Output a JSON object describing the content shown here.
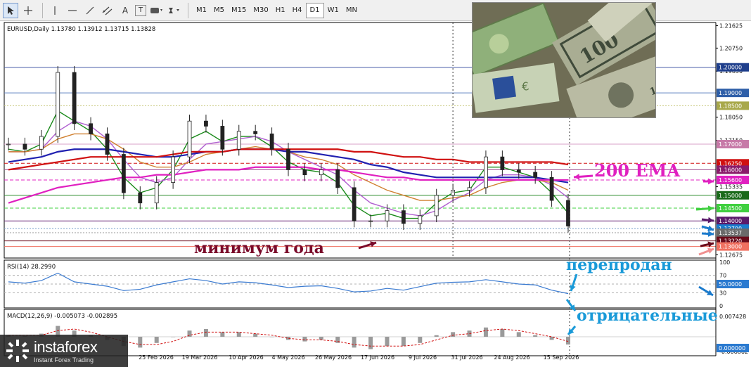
{
  "toolbar": {
    "tools": [
      "cursor-icon",
      "crosshair-icon",
      "vertical-line-icon",
      "horizontal-line-icon",
      "trendline-icon",
      "channel-icon",
      "text-tool-icon",
      "label-tool-icon",
      "shapes-icon",
      "arrows-icon"
    ],
    "text_tool": "A",
    "label_tool": "T",
    "timeframes": [
      "M1",
      "M5",
      "M15",
      "M30",
      "H1",
      "H4",
      "D1",
      "W1",
      "MN"
    ],
    "active_timeframe": "D1"
  },
  "header": {
    "symbol_info": "EURUSD,Daily  1.13780 1.13912 1.13715 1.13828"
  },
  "price_axis": {
    "ticks": [
      "1.21625",
      "1.20750",
      "1.19850",
      "1.18050",
      "1.17150",
      "1.15335",
      "1.12675"
    ],
    "levels": [
      {
        "label": "1.20000",
        "value": 1.2,
        "bg": "#1f3f8c",
        "fg": "#ffffff",
        "line": "#4a5fa8",
        "style": "solid"
      },
      {
        "label": "1.19000",
        "value": 1.19,
        "bg": "#2f5fa8",
        "fg": "#ffffff",
        "line": "#5b7fbf",
        "style": "solid"
      },
      {
        "label": "1.18500",
        "value": 1.185,
        "bg": "#a8a84a",
        "fg": "#ffffff",
        "line": "#c8c87a",
        "style": "dotted"
      },
      {
        "label": "1.17000",
        "value": 1.17,
        "bg": "#c77aa8",
        "fg": "#ffffff",
        "line": "#d8a0c8",
        "style": "solid"
      },
      {
        "label": "1.16250",
        "value": 1.1625,
        "bg": "#d01010",
        "fg": "#ffffff",
        "line": "#d01010",
        "style": "dashed"
      },
      {
        "label": "1.16000",
        "value": 1.16,
        "bg": "#8a1a6a",
        "fg": "#ffffff",
        "line": "#a05090",
        "style": "solid"
      },
      {
        "label": "1.15600",
        "value": 1.156,
        "bg": "#e020c0",
        "fg": "#ffffff",
        "line": "#e020c0",
        "style": "dashed"
      },
      {
        "label": "1.15000",
        "value": 1.15,
        "bg": "#1a6a1a",
        "fg": "#ffffff",
        "line": "#2a8a2a",
        "style": "solid"
      },
      {
        "label": "1.14500",
        "value": 1.145,
        "bg": "#40d040",
        "fg": "#ffffff",
        "line": "#40d040",
        "style": "dashed"
      },
      {
        "label": "1.14000",
        "value": 1.14,
        "bg": "#5a1a6a",
        "fg": "#ffffff",
        "line": "#6a2a7a",
        "style": "solid"
      },
      {
        "label": "1.13700",
        "value": 1.137,
        "bg": "#1a7acc",
        "fg": "#ffffff",
        "line": "#7aa0cc",
        "style": "dotted"
      },
      {
        "label": "1.13537",
        "value": 1.13537,
        "bg": "#6a6a6a",
        "fg": "#ffffff",
        "line": "#9a9a9a",
        "style": "dotted"
      },
      {
        "label": "1.13220",
        "value": 1.1322,
        "bg": "#6a0a1a",
        "fg": "#ffffff",
        "line": "#6a0a1a",
        "style": "solid"
      },
      {
        "label": "1.13000",
        "value": 1.13,
        "bg": "#f07060",
        "fg": "#ffffff",
        "line": "#f07060",
        "style": "solid"
      }
    ]
  },
  "date_axis": [
    "25 Feb 2026",
    "19 Mar 2026",
    "10 Apr 2026",
    "4 May 2026",
    "26 May 2026",
    "17 Jun 2026",
    "9 Jul 2026",
    "31 Jul 2026",
    "24 Aug 2026",
    "15 Sep 2026"
  ],
  "rsi": {
    "label": "RSI(14) 28.2990",
    "ticks": [
      "100",
      "70",
      "30",
      "0"
    ],
    "badge": "50.0000",
    "badge_bg": "#2a7ad0"
  },
  "macd": {
    "label": "MACD(12,26,9) -0.005073 -0.002895",
    "ticks": [
      "0.007428",
      "-0.008862"
    ],
    "badge": "0.000000",
    "badge_bg": "#2a7ad0"
  },
  "annotations": {
    "ema": {
      "text": "200 EMA",
      "color": "#e020c0"
    },
    "year_low": {
      "text": "минимум года",
      "color": "#7a0a2a"
    },
    "oversold": {
      "text": "перепродан",
      "color": "#1a9ad8"
    },
    "negative": {
      "text": "отрицательные",
      "color": "#1a9ad8"
    }
  },
  "logo": {
    "name": "instaforex",
    "tagline": "Instant Forex Trading"
  },
  "chart_data": {
    "type": "candlestick",
    "symbol": "EURUSD",
    "timeframe": "Daily",
    "last_ohlc": {
      "open": 1.1378,
      "high": 1.13912,
      "low": 1.13715,
      "close": 1.13828
    },
    "ylim": [
      1.1255,
      1.2175
    ],
    "x": [
      "2026-01-26",
      "2026-02-02",
      "2026-02-09",
      "2026-02-16",
      "2026-02-23",
      "2026-03-02",
      "2026-03-09",
      "2026-03-16",
      "2026-03-23",
      "2026-03-30",
      "2026-04-06",
      "2026-04-13",
      "2026-04-20",
      "2026-04-27",
      "2026-05-04",
      "2026-05-11",
      "2026-05-18",
      "2026-05-25",
      "2026-06-01",
      "2026-06-08",
      "2026-06-15",
      "2026-06-22",
      "2026-06-29",
      "2026-07-06",
      "2026-07-13",
      "2026-07-20",
      "2026-07-27",
      "2026-08-03",
      "2026-08-10",
      "2026-08-17",
      "2026-08-24",
      "2026-08-31",
      "2026-09-07",
      "2026-09-14",
      "2026-09-21"
    ],
    "series": [
      {
        "name": "",
        "role": "price",
        "color": "#222222",
        "values": [
          1.17,
          1.168,
          1.173,
          1.198,
          1.178,
          1.174,
          1.166,
          1.151,
          1.147,
          1.155,
          1.165,
          1.179,
          1.177,
          1.168,
          1.175,
          1.174,
          1.168,
          1.16,
          1.158,
          1.16,
          1.153,
          1.14,
          1.14,
          1.144,
          1.139,
          1.142,
          1.15,
          1.152,
          1.153,
          1.165,
          1.16,
          1.159,
          1.157,
          1.148,
          1.138
        ]
      },
      {
        "name": "",
        "role": "ma-fast",
        "color": "#1a8a1a",
        "values": [
          1.168,
          1.167,
          1.17,
          1.183,
          1.179,
          1.175,
          1.168,
          1.157,
          1.151,
          1.153,
          1.16,
          1.172,
          1.175,
          1.171,
          1.173,
          1.173,
          1.169,
          1.163,
          1.16,
          1.159,
          1.155,
          1.146,
          1.142,
          1.143,
          1.141,
          1.141,
          1.147,
          1.151,
          1.152,
          1.161,
          1.161,
          1.159,
          1.157,
          1.151,
          1.143
        ]
      },
      {
        "name": "",
        "role": "ma-mid",
        "color": "#b060d0",
        "values": [
          1.167,
          1.167,
          1.168,
          1.175,
          1.179,
          1.177,
          1.172,
          1.164,
          1.157,
          1.155,
          1.157,
          1.164,
          1.17,
          1.171,
          1.172,
          1.173,
          1.171,
          1.167,
          1.164,
          1.161,
          1.158,
          1.152,
          1.147,
          1.145,
          1.143,
          1.142,
          1.144,
          1.148,
          1.151,
          1.156,
          1.158,
          1.158,
          1.157,
          1.154,
          1.149
        ]
      },
      {
        "name": "",
        "role": "ma-slow",
        "color": "#d08030",
        "values": [
          1.167,
          1.167,
          1.168,
          1.172,
          1.174,
          1.174,
          1.172,
          1.168,
          1.163,
          1.161,
          1.161,
          1.163,
          1.166,
          1.167,
          1.168,
          1.169,
          1.168,
          1.167,
          1.165,
          1.164,
          1.162,
          1.158,
          1.155,
          1.152,
          1.15,
          1.148,
          1.148,
          1.149,
          1.15,
          1.153,
          1.155,
          1.156,
          1.156,
          1.155,
          1.152
        ]
      },
      {
        "name": "",
        "role": "ma-long",
        "color": "#2020b0",
        "values": [
          1.163,
          1.164,
          1.165,
          1.167,
          1.168,
          1.168,
          1.168,
          1.167,
          1.166,
          1.165,
          1.165,
          1.166,
          1.167,
          1.167,
          1.168,
          1.168,
          1.168,
          1.167,
          1.167,
          1.166,
          1.165,
          1.164,
          1.162,
          1.161,
          1.159,
          1.158,
          1.157,
          1.157,
          1.157,
          1.157,
          1.157,
          1.157,
          1.157,
          1.156,
          1.155
        ]
      },
      {
        "name": "",
        "role": "ema-200",
        "color": "#d01010",
        "values": [
          1.16,
          1.161,
          1.162,
          1.163,
          1.164,
          1.165,
          1.165,
          1.165,
          1.165,
          1.165,
          1.166,
          1.167,
          1.167,
          1.167,
          1.168,
          1.168,
          1.168,
          1.168,
          1.168,
          1.168,
          1.168,
          1.167,
          1.167,
          1.166,
          1.165,
          1.165,
          1.164,
          1.164,
          1.163,
          1.163,
          1.163,
          1.163,
          1.163,
          1.163,
          1.162
        ]
      },
      {
        "name": "",
        "role": "ma-magenta",
        "color": "#e020c0",
        "values": [
          1.147,
          1.149,
          1.151,
          1.153,
          1.154,
          1.155,
          1.156,
          1.157,
          1.157,
          1.158,
          1.158,
          1.159,
          1.16,
          1.16,
          1.16,
          1.161,
          1.161,
          1.161,
          1.161,
          1.16,
          1.16,
          1.159,
          1.158,
          1.157,
          1.157,
          1.156,
          1.156,
          1.156,
          1.156,
          1.156,
          1.156,
          1.156,
          1.156,
          1.156,
          1.156
        ]
      }
    ],
    "rsi_values": [
      55,
      52,
      58,
      75,
      55,
      50,
      45,
      35,
      38,
      48,
      55,
      62,
      58,
      50,
      55,
      53,
      48,
      42,
      45,
      46,
      40,
      32,
      34,
      40,
      36,
      44,
      52,
      54,
      55,
      60,
      55,
      50,
      48,
      36,
      28
    ],
    "rsi_levels": [
      70,
      50,
      30
    ],
    "macd_values": [
      0.001,
      0.0005,
      0.002,
      0.007,
      0.004,
      0.001,
      -0.002,
      -0.006,
      -0.007,
      -0.004,
      0.0,
      0.004,
      0.005,
      0.003,
      0.003,
      0.002,
      0.0,
      -0.002,
      -0.003,
      -0.002,
      -0.004,
      -0.007,
      -0.008,
      -0.006,
      -0.006,
      -0.004,
      0.001,
      0.003,
      0.004,
      0.006,
      0.005,
      0.003,
      0.001,
      -0.002,
      -0.005
    ],
    "macd_signal": [
      0.001,
      0.001,
      0.001,
      0.004,
      0.005,
      0.003,
      0.0,
      -0.003,
      -0.005,
      -0.005,
      -0.003,
      0.001,
      0.003,
      0.003,
      0.003,
      0.002,
      0.001,
      -0.001,
      -0.002,
      -0.002,
      -0.003,
      -0.005,
      -0.006,
      -0.006,
      -0.006,
      -0.005,
      -0.002,
      0.001,
      0.002,
      0.004,
      0.005,
      0.004,
      0.002,
      0.0,
      -0.003
    ]
  }
}
